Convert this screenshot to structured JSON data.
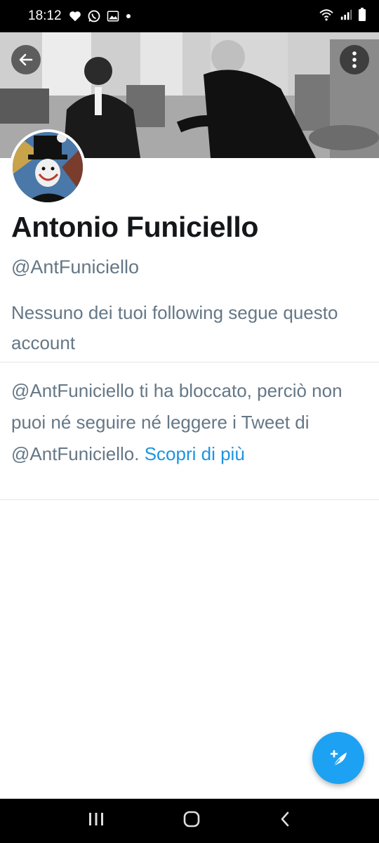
{
  "status_bar": {
    "time": "18:12",
    "icons": [
      "heart-icon",
      "whatsapp-icon",
      "gallery-icon",
      "dot-icon",
      "wifi-icon",
      "signal-icon",
      "battery-icon"
    ]
  },
  "profile": {
    "display_name": "Antonio Funiciello",
    "handle": "@AntFuniciello",
    "followers_note": "Nessuno dei tuoi following segue questo account"
  },
  "blocked_notice": {
    "text": "@AntFuniciello ti ha bloccato, perciò non puoi né seguire né leggere i Tweet di @AntFuniciello.",
    "link_label": "Scopri di più"
  },
  "colors": {
    "accent": "#1da1f2",
    "link": "#1b95e0",
    "secondary_text": "#657786",
    "primary_text": "#14171a"
  },
  "nav_bar": {
    "icons": [
      "recent-apps-icon",
      "home-icon",
      "back-nav-icon"
    ]
  }
}
